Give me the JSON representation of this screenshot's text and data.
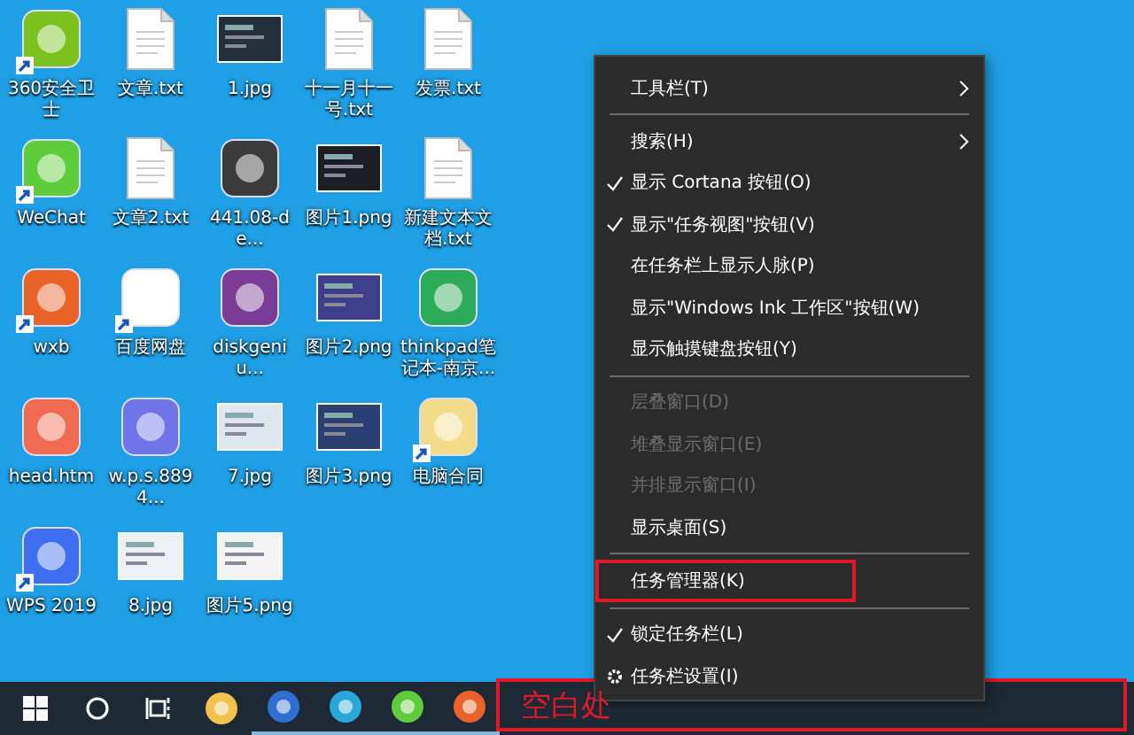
{
  "desktop": {
    "icons": [
      {
        "label": "360安全卫士",
        "kind": "app",
        "color": "#7cc21f",
        "shortcut": true
      },
      {
        "label": "文章.txt",
        "kind": "text-file",
        "shortcut": false
      },
      {
        "label": "1.jpg",
        "kind": "image",
        "color": "#23303c",
        "shortcut": false
      },
      {
        "label": "十一月十一号.txt",
        "kind": "text-file",
        "shortcut": false
      },
      {
        "label": "发票.txt",
        "kind": "text-file",
        "shortcut": false
      },
      {
        "label": "WeChat",
        "kind": "app",
        "color": "#5fcd3b",
        "shortcut": true
      },
      {
        "label": "文章2.txt",
        "kind": "text-file",
        "shortcut": false
      },
      {
        "label": "441.08-de...",
        "kind": "app",
        "color": "#3b3b3b",
        "shortcut": false
      },
      {
        "label": "图片1.png",
        "kind": "image",
        "color": "#1b1f25",
        "shortcut": false
      },
      {
        "label": "新建文本文档.txt",
        "kind": "text-file",
        "shortcut": false
      },
      {
        "label": "wxb",
        "kind": "app",
        "color": "#e8622a",
        "shortcut": true
      },
      {
        "label": "百度网盘",
        "kind": "app",
        "color": "#ffffff",
        "shortcut": true
      },
      {
        "label": "diskgeniu...",
        "kind": "app",
        "color": "#7a3c96",
        "shortcut": false
      },
      {
        "label": "图片2.png",
        "kind": "image",
        "color": "#3d3f8a",
        "shortcut": false
      },
      {
        "label": "thinkpad笔记本-南京...",
        "kind": "app",
        "color": "#2eab59",
        "shortcut": false
      },
      {
        "label": "head.htm",
        "kind": "app",
        "color": "#f06b52",
        "shortcut": false
      },
      {
        "label": "w.p.s.8894...",
        "kind": "app",
        "color": "#6f75e8",
        "shortcut": false
      },
      {
        "label": "7.jpg",
        "kind": "image",
        "color": "#dfe6ee",
        "shortcut": false
      },
      {
        "label": "图片3.png",
        "kind": "image",
        "color": "#2b3f72",
        "shortcut": false
      },
      {
        "label": "电脑合同",
        "kind": "app",
        "color": "#f2dc8a",
        "shortcut": true
      },
      {
        "label": "WPS 2019",
        "kind": "app",
        "color": "#3d6ff0",
        "shortcut": true
      },
      {
        "label": "8.jpg",
        "kind": "image",
        "color": "#eef0f3",
        "shortcut": false
      },
      {
        "label": "图片5.png",
        "kind": "image",
        "color": "#f4f4f4",
        "shortcut": false
      }
    ]
  },
  "context_menu": {
    "items": [
      {
        "kind": "item",
        "label": "工具栏(T)",
        "checked": false,
        "disabled": false,
        "submenu": true,
        "outlined": false
      },
      {
        "kind": "separator"
      },
      {
        "kind": "item",
        "label": "搜索(H)",
        "checked": false,
        "disabled": false,
        "submenu": true,
        "outlined": false
      },
      {
        "kind": "item",
        "label": "显示 Cortana 按钮(O)",
        "checked": true,
        "disabled": false,
        "submenu": false,
        "outlined": false
      },
      {
        "kind": "item",
        "label": "显示\"任务视图\"按钮(V)",
        "checked": true,
        "disabled": false,
        "submenu": false,
        "outlined": false
      },
      {
        "kind": "item",
        "label": "在任务栏上显示人脉(P)",
        "checked": false,
        "disabled": false,
        "submenu": false,
        "outlined": false
      },
      {
        "kind": "item",
        "label": "显示\"Windows Ink 工作区\"按钮(W)",
        "checked": false,
        "disabled": false,
        "submenu": false,
        "outlined": false
      },
      {
        "kind": "item",
        "label": "显示触摸键盘按钮(Y)",
        "checked": false,
        "disabled": false,
        "submenu": false,
        "outlined": false
      },
      {
        "kind": "separator"
      },
      {
        "kind": "item",
        "label": "层叠窗口(D)",
        "checked": false,
        "disabled": true,
        "submenu": false,
        "outlined": false
      },
      {
        "kind": "item",
        "label": "堆叠显示窗口(E)",
        "checked": false,
        "disabled": true,
        "submenu": false,
        "outlined": false
      },
      {
        "kind": "item",
        "label": "并排显示窗口(I)",
        "checked": false,
        "disabled": true,
        "submenu": false,
        "outlined": false
      },
      {
        "kind": "item",
        "label": "显示桌面(S)",
        "checked": false,
        "disabled": false,
        "submenu": false,
        "outlined": false
      },
      {
        "kind": "separator"
      },
      {
        "kind": "item",
        "label": "任务管理器(K)",
        "checked": false,
        "disabled": false,
        "submenu": false,
        "outlined": true
      },
      {
        "kind": "separator"
      },
      {
        "kind": "item",
        "label": "锁定任务栏(L)",
        "checked": true,
        "disabled": false,
        "submenu": false,
        "outlined": false
      },
      {
        "kind": "settings",
        "label": "任务栏设置(I)",
        "checked": false,
        "disabled": false,
        "submenu": false,
        "outlined": false
      }
    ]
  },
  "taskbar": {
    "items": [
      {
        "kind": "start",
        "running": false
      },
      {
        "kind": "search",
        "running": false
      },
      {
        "kind": "task-view",
        "running": false
      },
      {
        "kind": "app",
        "color": "#f2c14e",
        "running": false
      },
      {
        "kind": "app",
        "color": "#2f6fd0",
        "running": true
      },
      {
        "kind": "app",
        "color": "#2aa6d8",
        "running": true
      },
      {
        "kind": "app",
        "color": "#5fcd3b",
        "running": true
      },
      {
        "kind": "app",
        "color": "#e8622a",
        "running": true
      }
    ],
    "callout": {
      "label": "空白处"
    }
  }
}
